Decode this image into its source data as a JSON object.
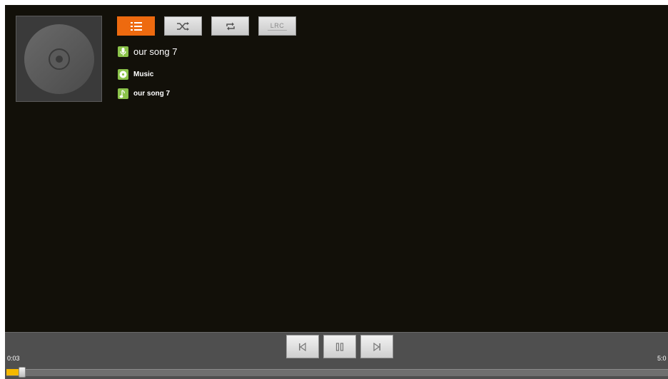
{
  "colors": {
    "background": "#121009",
    "accent": "#ee6a0f",
    "icon_green": "#8bc34a",
    "progress": "#f6b800",
    "bottom_bar": "#4f4f4f"
  },
  "album_art": {
    "icon": "cd-disc-icon"
  },
  "toolbar": {
    "playlist": {
      "icon": "playlist-icon",
      "active": true
    },
    "shuffle": {
      "icon": "shuffle-icon"
    },
    "repeat": {
      "icon": "repeat-icon"
    },
    "lrc": {
      "label": "LRC"
    }
  },
  "track": {
    "title": "our song 7",
    "title_icon": "microphone-icon",
    "album": "Music",
    "album_icon": "disc-icon",
    "artist": "our song 7",
    "artist_icon": "music-note-icon"
  },
  "controls": {
    "prev": "previous-icon",
    "pause": "pause-icon",
    "next": "next-icon"
  },
  "playback": {
    "current_time": "0:03",
    "total_time": "5:0",
    "progress_fraction": 0.01
  }
}
